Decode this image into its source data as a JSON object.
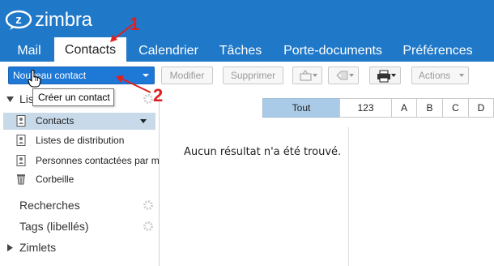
{
  "app": {
    "logo_text": "zimbra"
  },
  "tabs": [
    {
      "label": "Mail"
    },
    {
      "label": "Contacts"
    },
    {
      "label": "Calendrier"
    },
    {
      "label": "Tâches"
    },
    {
      "label": "Porte-documents"
    },
    {
      "label": "Préférences"
    }
  ],
  "toolbar": {
    "new_contact": "Nouveau contact",
    "edit": "Modifier",
    "delete": "Supprimer",
    "actions": "Actions"
  },
  "tooltip": {
    "text": "Créer un contact"
  },
  "left": {
    "lists_header": "Listes",
    "items": [
      {
        "label": "Contacts"
      },
      {
        "label": "Listes de distribution"
      },
      {
        "label": "Personnes contactées par mail"
      },
      {
        "label": "Corbeille"
      }
    ],
    "searches": "Recherches",
    "tags": "Tags (libellés)",
    "zimlets": "Zimlets"
  },
  "alpha": [
    "Tout",
    "123",
    "A",
    "B",
    "C",
    "D"
  ],
  "list": {
    "empty": "Aucun résultat n'a été trouvé."
  },
  "annotations": [
    "1",
    "2"
  ],
  "colors": {
    "header": "#1f78c8",
    "primary_button": "#1e78d6",
    "selected_row": "#c8daea",
    "alpha_active": "#a9cbe8",
    "annotation": "#e02020"
  }
}
